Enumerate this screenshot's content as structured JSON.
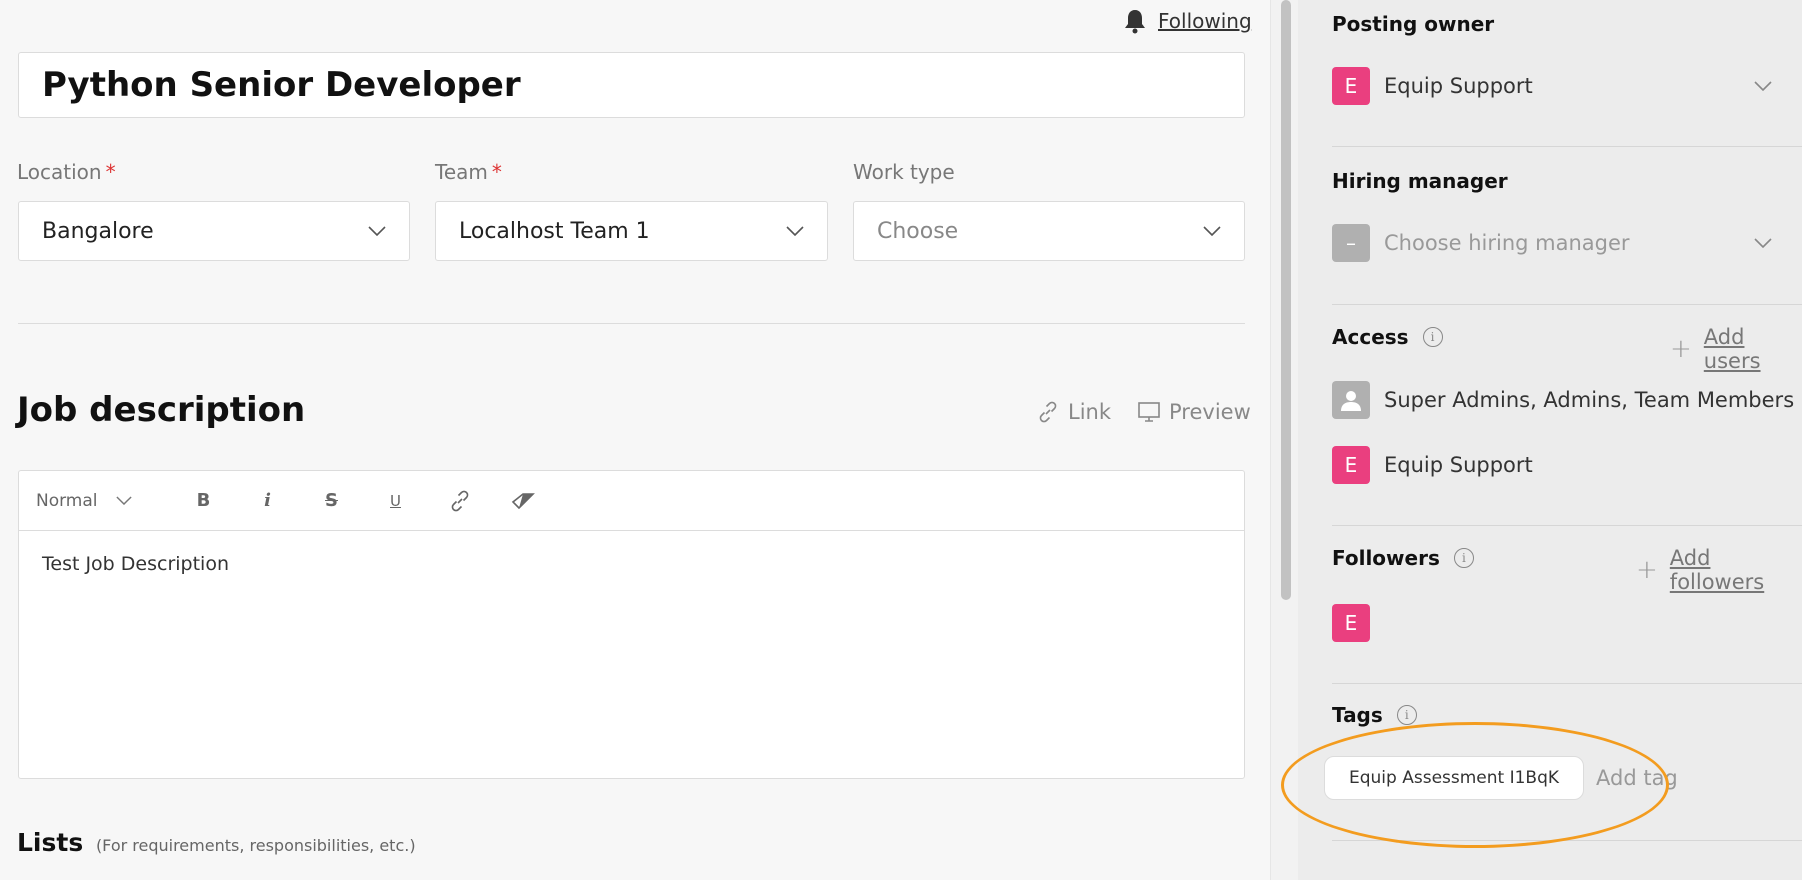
{
  "header": {
    "following_label": "Following"
  },
  "posting": {
    "title": "Python Senior Developer"
  },
  "fields": {
    "location": {
      "label": "Location",
      "required_mark": "*",
      "value": "Bangalore"
    },
    "team": {
      "label": "Team",
      "required_mark": "*",
      "value": "Localhost Team 1"
    },
    "work_type": {
      "label": "Work type",
      "value": "Choose"
    }
  },
  "job_description": {
    "heading": "Job description",
    "link_label": "Link",
    "preview_label": "Preview",
    "toolbar": {
      "format_select": "Normal",
      "bold": "B",
      "italic": "i",
      "strike": "S",
      "underline": "U"
    },
    "body_text": "Test Job Description"
  },
  "lists": {
    "heading": "Lists",
    "subheading": "(For requirements, responsibilities, etc.)"
  },
  "sidebar": {
    "posting_owner": {
      "label": "Posting owner",
      "avatar_letter": "E",
      "name": "Equip Support"
    },
    "hiring_manager": {
      "label": "Hiring manager",
      "avatar_letter": "–",
      "placeholder": "Choose hiring manager"
    },
    "access": {
      "label": "Access",
      "add_label": "Add users",
      "items": [
        {
          "avatar": "group",
          "text": "Super Admins, Admins, Team Members"
        },
        {
          "avatar_letter": "E",
          "text": "Equip Support"
        }
      ]
    },
    "followers": {
      "label": "Followers",
      "add_label": "Add followers",
      "avatar_letter": "E"
    },
    "tags": {
      "label": "Tags",
      "chip": "Equip Assessment I1BqK",
      "add_label": "Add tag"
    }
  },
  "colors": {
    "avatar_pink": "#ea3f7f",
    "highlight": "#f39c1f",
    "required": "#d33333"
  }
}
